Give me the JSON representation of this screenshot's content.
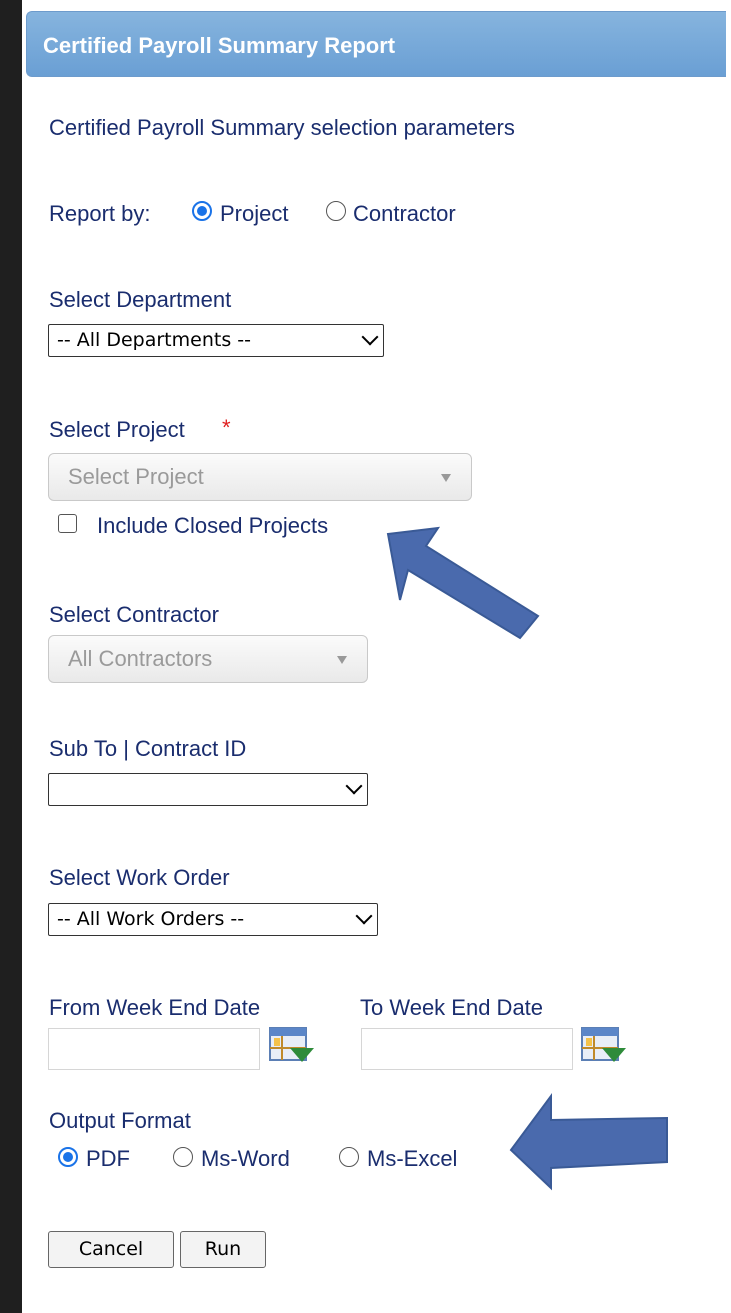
{
  "header": {
    "title": "Certified Payroll Summary Report"
  },
  "intro": "Certified Payroll Summary selection parameters",
  "report_by": {
    "label": "Report by:",
    "options": [
      {
        "label": "Project",
        "selected": true
      },
      {
        "label": "Contractor",
        "selected": false
      }
    ]
  },
  "department": {
    "label": "Select Department",
    "value": "-- All Departments --"
  },
  "project": {
    "label": "Select Project",
    "required_mark": "*",
    "value": "Select Project",
    "include_closed_label": "Include Closed Projects",
    "include_closed_checked": false
  },
  "contractor": {
    "label": "Select Contractor",
    "value": "All Contractors"
  },
  "sub_to": {
    "label": "Sub To | Contract ID",
    "value": ""
  },
  "work_order": {
    "label": "Select Work Order",
    "value": "-- All Work Orders --"
  },
  "dates": {
    "from_label": "From Week End Date",
    "to_label": "To Week End Date",
    "from_value": "",
    "to_value": ""
  },
  "output_format": {
    "label": "Output Format",
    "options": [
      {
        "label": "PDF",
        "selected": true
      },
      {
        "label": "Ms-Word",
        "selected": false
      },
      {
        "label": "Ms-Excel",
        "selected": false
      }
    ]
  },
  "buttons": {
    "cancel": "Cancel",
    "run": "Run"
  },
  "colors": {
    "header": "#6a9fd4",
    "label_navy": "#1a2d6e",
    "radio_accent": "#1a73e8",
    "required": "#e02020",
    "annotation_arrow": "#4a6aad"
  }
}
